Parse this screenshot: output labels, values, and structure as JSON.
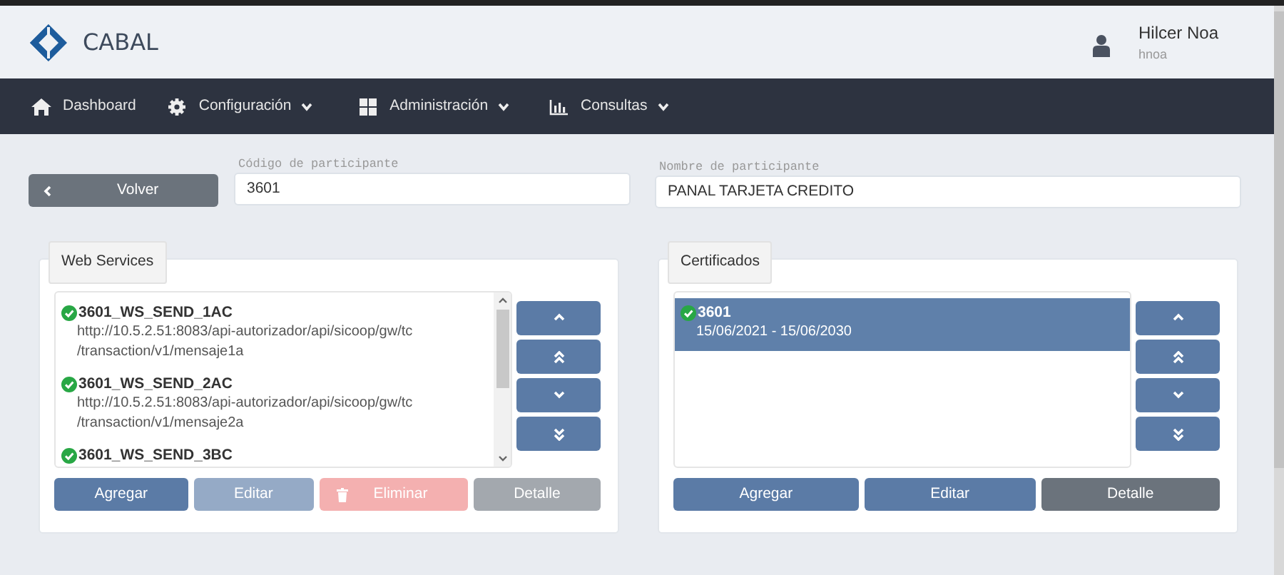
{
  "brand": {
    "name": "CABAL"
  },
  "user": {
    "name": "Hilcer Noa",
    "login": "hnoa"
  },
  "nav": [
    {
      "label": "Dashboard",
      "dropdown": false
    },
    {
      "label": "Configuración",
      "dropdown": true
    },
    {
      "label": "Administración",
      "dropdown": true
    },
    {
      "label": "Consultas",
      "dropdown": true
    }
  ],
  "back_button": {
    "label": "Volver"
  },
  "fields": [
    {
      "label": "Código de participante",
      "value": "3601"
    },
    {
      "label": "Nombre de participante",
      "value": "PANAL TARJETA CREDITO"
    }
  ],
  "panels": [
    {
      "title": "Web Services",
      "scrollable": true,
      "items": [
        {
          "name": "3601_WS_SEND_1AC",
          "detail": "http://10.5.2.51:8083/api-autorizador/api/sicoop/gw/tc\n/transaction/v1/mensaje1a",
          "selected": false
        },
        {
          "name": "3601_WS_SEND_2AC",
          "detail": "http://10.5.2.51:8083/api-autorizador/api/sicoop/gw/tc\n/transaction/v1/mensaje2a",
          "selected": false
        },
        {
          "name": "3601_WS_SEND_3BC",
          "selected": false
        }
      ],
      "buttons": [
        {
          "label": "Agregar",
          "kind": "primary",
          "disabled": false
        },
        {
          "label": "Editar",
          "kind": "primary",
          "disabled": true
        },
        {
          "label": "Eliminar",
          "kind": "danger",
          "disabled": true
        },
        {
          "label": "Detalle",
          "kind": "secondary",
          "disabled": true
        }
      ]
    },
    {
      "title": "Certificados",
      "scrollable": false,
      "items": [
        {
          "name": "3601",
          "detail": "15/06/2021 - 15/06/2030",
          "selected": true
        }
      ],
      "buttons": [
        {
          "label": "Agregar",
          "kind": "primary",
          "disabled": false
        },
        {
          "label": "Editar",
          "kind": "primary",
          "disabled": false
        },
        {
          "label": "Detalle",
          "kind": "secondary",
          "disabled": false
        }
      ]
    }
  ]
}
